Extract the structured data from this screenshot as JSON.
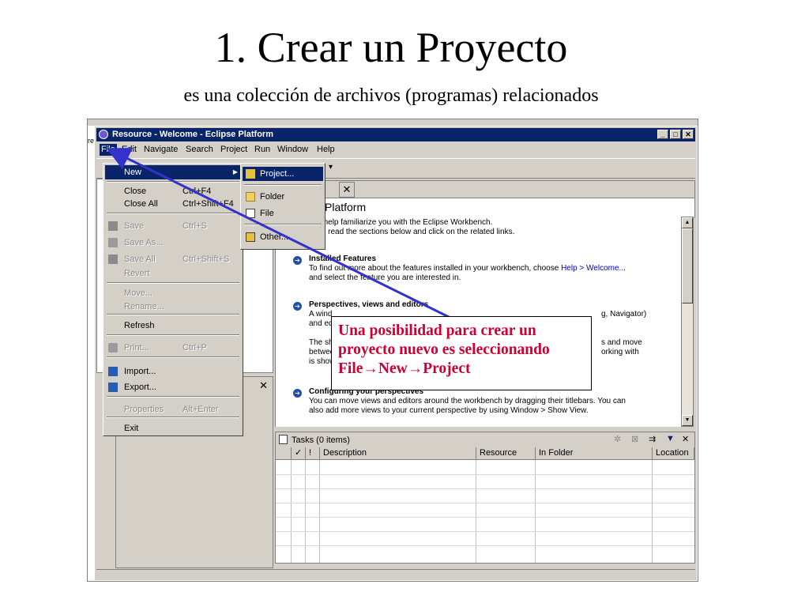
{
  "slide": {
    "title": "1. Crear un Proyecto",
    "subtitle": "es una colección de archivos (programas) relacionados"
  },
  "window": {
    "title": "Resource - Welcome - Eclipse Platform",
    "left_edge_text": "re"
  },
  "menubar": [
    "File",
    "Edit",
    "Navigate",
    "Search",
    "Project",
    "Run",
    "Window",
    "Help"
  ],
  "file_menu": {
    "items": [
      {
        "label": "New",
        "accel": "",
        "state": "highlighted",
        "submenu": true
      },
      {
        "label": "Close",
        "accel": "Ctrl+F4",
        "state": "enabled"
      },
      {
        "label": "Close All",
        "accel": "Ctrl+Shift+F4",
        "state": "enabled"
      },
      {
        "label": "Save",
        "accel": "Ctrl+S",
        "state": "disabled",
        "icon": "save-icon"
      },
      {
        "label": "Save As...",
        "accel": "",
        "state": "disabled",
        "icon": "save-as-icon"
      },
      {
        "label": "Save All",
        "accel": "Ctrl+Shift+S",
        "state": "disabled",
        "icon": "save-all-icon"
      },
      {
        "label": "Revert",
        "accel": "",
        "state": "disabled"
      },
      {
        "label": "Move...",
        "accel": "",
        "state": "disabled"
      },
      {
        "label": "Rename...",
        "accel": "",
        "state": "disabled"
      },
      {
        "label": "Refresh",
        "accel": "",
        "state": "enabled"
      },
      {
        "label": "Print...",
        "accel": "Ctrl+P",
        "state": "disabled",
        "icon": "print-icon"
      },
      {
        "label": "Import...",
        "accel": "",
        "state": "enabled",
        "icon": "import-icon"
      },
      {
        "label": "Export...",
        "accel": "",
        "state": "enabled",
        "icon": "export-icon"
      },
      {
        "label": "Properties",
        "accel": "Alt+Enter",
        "state": "disabled"
      },
      {
        "label": "Exit",
        "accel": "",
        "state": "enabled"
      }
    ]
  },
  "new_submenu": {
    "items": [
      {
        "label": "Project...",
        "state": "highlighted",
        "icon": "project-icon"
      },
      {
        "label": "Folder",
        "state": "enabled",
        "icon": "folder-icon"
      },
      {
        "label": "File",
        "state": "enabled",
        "icon": "file-icon"
      },
      {
        "label": "Other...",
        "state": "enabled",
        "icon": "other-icon"
      }
    ]
  },
  "left_panel": {
    "close_glyph": "✕"
  },
  "welcome": {
    "tab_label": "e",
    "tab_close_glyph": "✕",
    "header": "Platform",
    "intro_line1": "ge will help familiarize you with the Eclipse Workbench.",
    "intro_line2": "started, read the sections below and click on the related links.",
    "sections": [
      {
        "heading": "Installed Features",
        "line1": "To find out more about the features installed in your workbench, choose ",
        "line1_link": "Help > Welcome...",
        "line2": "and select the feature you are interested in."
      },
      {
        "heading": "Perspectives, views and editors",
        "line1": "A wind",
        "line1_tail": "g, Navigator)",
        "line2": "and edi",
        "line3": "The sh",
        "line3_tail": "s and move",
        "line4": "betwee",
        "line4_tail": "orking with",
        "line5": "is show"
      },
      {
        "heading": "Configuring your perspectives",
        "line1": "You can move views and editors around the workbench by dragging their titlebars. You can",
        "line2": "also add more views to your current perspective by using Window > Show View."
      }
    ]
  },
  "tasks": {
    "title": "Tasks (0 items)",
    "close_glyph": "✕",
    "columns": [
      "",
      "✓",
      "!",
      "Description",
      "Resource",
      "In Folder",
      "Location"
    ]
  },
  "callout": {
    "line1": "Una posibilidad para crear un",
    "line2": "proyecto nuevo es seleccionando",
    "line3": "File→New→Project",
    "color": "#cc0033"
  },
  "colors": {
    "titlebar": "#0a246a",
    "arrow": "#3333cc",
    "chrome": "#d4d0c8"
  }
}
